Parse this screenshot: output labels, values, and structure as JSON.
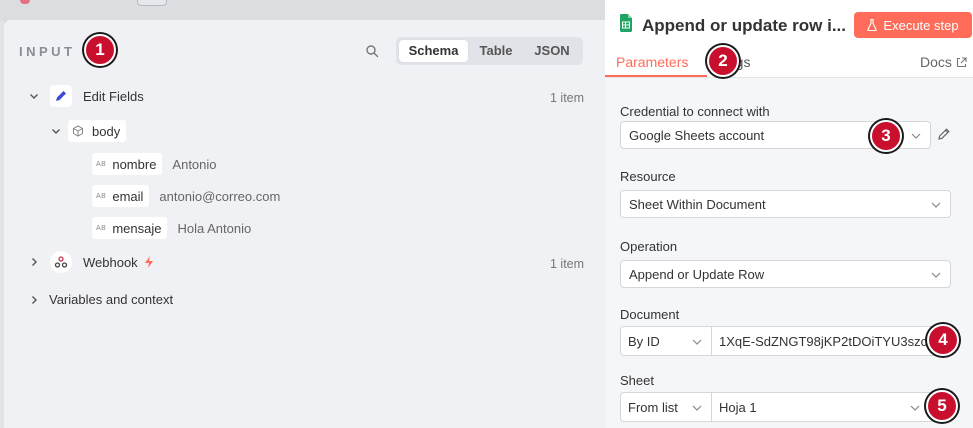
{
  "input": {
    "title": "INPUT",
    "tabs": [
      "Schema",
      "Table",
      "JSON"
    ],
    "items": [
      {
        "label": "Edit Fields",
        "count": "1 item"
      },
      {
        "label": "body"
      },
      {
        "label": "Webhook",
        "count": "1 item"
      },
      {
        "label": "Variables and context"
      }
    ],
    "fields": [
      {
        "type": "AB",
        "key": "nombre",
        "value": "Antonio"
      },
      {
        "type": "AB",
        "key": "email",
        "value": "antonio@correo.com"
      },
      {
        "type": "AB",
        "key": "mensaje",
        "value": "Hola Antonio"
      }
    ]
  },
  "node": {
    "title": "Append or update row i...",
    "execute_label": "Execute step",
    "tabs": {
      "parameters": "Parameters",
      "settings": "ttings",
      "docs": "Docs"
    }
  },
  "params": {
    "credential_label": "Credential to connect with",
    "credential_value": "Google Sheets account",
    "resource_label": "Resource",
    "resource_value": "Sheet Within Document",
    "operation_label": "Operation",
    "operation_value": "Append or Update Row",
    "document_label": "Document",
    "document_mode": "By ID",
    "document_value": "1XqE-SdZNGT98jKP2tDOiTYU3szcX",
    "sheet_label": "Sheet",
    "sheet_mode": "From list",
    "sheet_value": "Hoja 1"
  },
  "badges": [
    "1",
    "2",
    "3",
    "4",
    "5"
  ],
  "colors": {
    "accent": "#ff6d5a",
    "badge": "#c8102e"
  }
}
